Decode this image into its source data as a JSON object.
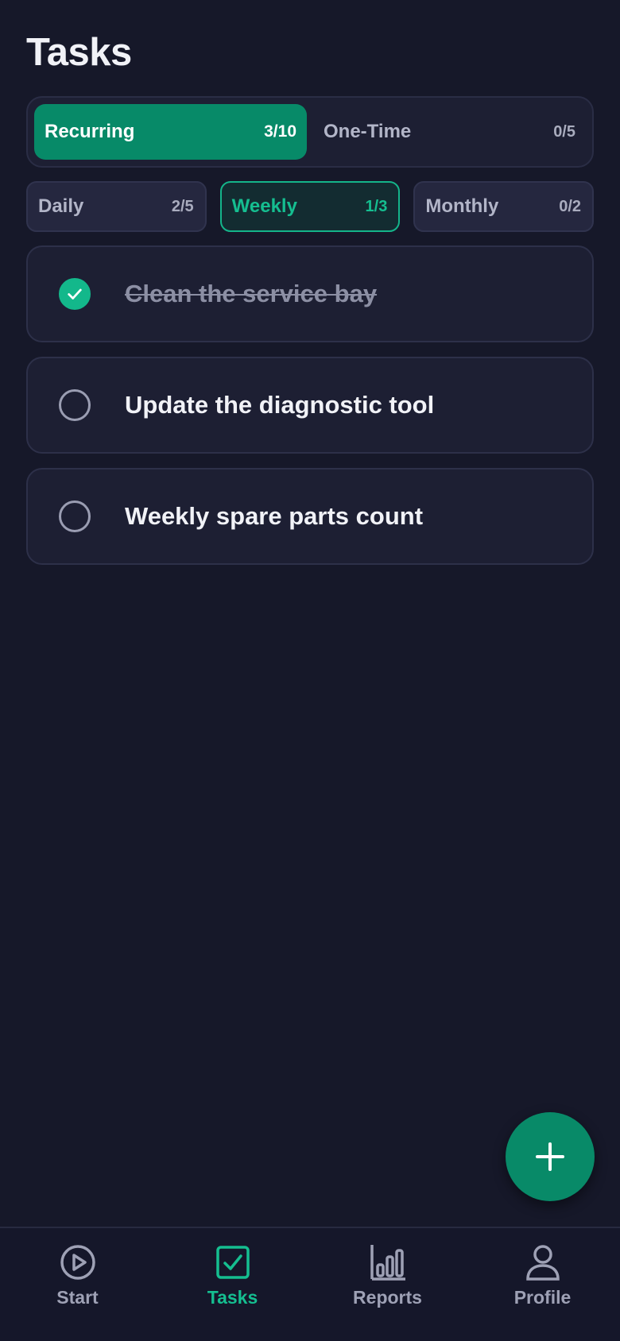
{
  "header": {
    "title": "Tasks"
  },
  "segments": [
    {
      "label": "Recurring",
      "count": "3/10",
      "active": true
    },
    {
      "label": "One-Time",
      "count": "0/5",
      "active": false
    }
  ],
  "filters": [
    {
      "label": "Daily",
      "count": "2/5",
      "active": false
    },
    {
      "label": "Weekly",
      "count": "1/3",
      "active": true
    },
    {
      "label": "Monthly",
      "count": "0/2",
      "active": false
    }
  ],
  "tasks": [
    {
      "label": "Clean the service bay",
      "done": true
    },
    {
      "label": "Update the diagnostic tool",
      "done": false
    },
    {
      "label": "Weekly spare parts count",
      "done": false
    }
  ],
  "fab": {
    "icon": "plus-icon"
  },
  "nav": [
    {
      "label": "Start",
      "icon": "play-circle-icon",
      "active": false
    },
    {
      "label": "Tasks",
      "icon": "checkbox-icon",
      "active": true
    },
    {
      "label": "Reports",
      "icon": "bar-chart-icon",
      "active": false
    },
    {
      "label": "Profile",
      "icon": "user-icon",
      "active": false
    }
  ],
  "colors": {
    "background": "#161829",
    "accent": "#078A68",
    "accent_bright": "#15BE90",
    "card": "#1D1F33",
    "muted": "#9EA1B5"
  }
}
